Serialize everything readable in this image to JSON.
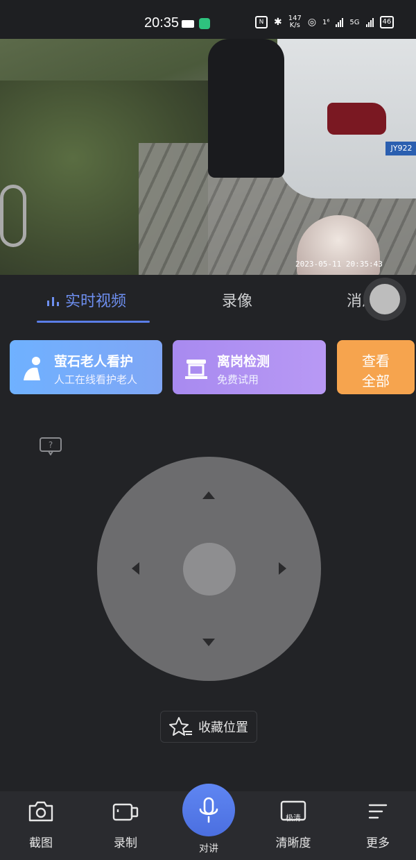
{
  "status_bar": {
    "time": "20:35",
    "net_speed": "147",
    "net_unit": "K/s",
    "signal_1": "1⁶",
    "signal_2": "5G",
    "battery": "46"
  },
  "video": {
    "timestamp": "2023-05-11 20:35:43",
    "plate_text": "JY922"
  },
  "tabs": [
    {
      "label": "实时视频",
      "active": true
    },
    {
      "label": "录像",
      "active": false
    },
    {
      "label": "消息",
      "active": false
    }
  ],
  "cards": [
    {
      "title": "萤石老人看护",
      "subtitle": "人工在线看护老人",
      "color": "#6fb1ff"
    },
    {
      "title": "离岗检测",
      "subtitle": "免费试用",
      "color": "#a88af0"
    },
    {
      "title_line1": "查看",
      "title_line2": "全部",
      "color": "#f6a44e"
    }
  ],
  "help_icon": "question-icon",
  "favorite": {
    "label": "收藏位置"
  },
  "bottom_bar": [
    {
      "label": "截图",
      "icon": "camera-icon"
    },
    {
      "label": "录制",
      "icon": "video-record-icon"
    },
    {
      "label": "对讲",
      "icon": "microphone-icon"
    },
    {
      "label": "清晰度",
      "icon": "quality-icon",
      "badge": "极清"
    },
    {
      "label": "更多",
      "icon": "menu-icon"
    }
  ],
  "colors": {
    "accent": "#5b7ee8",
    "background": "#222326"
  }
}
